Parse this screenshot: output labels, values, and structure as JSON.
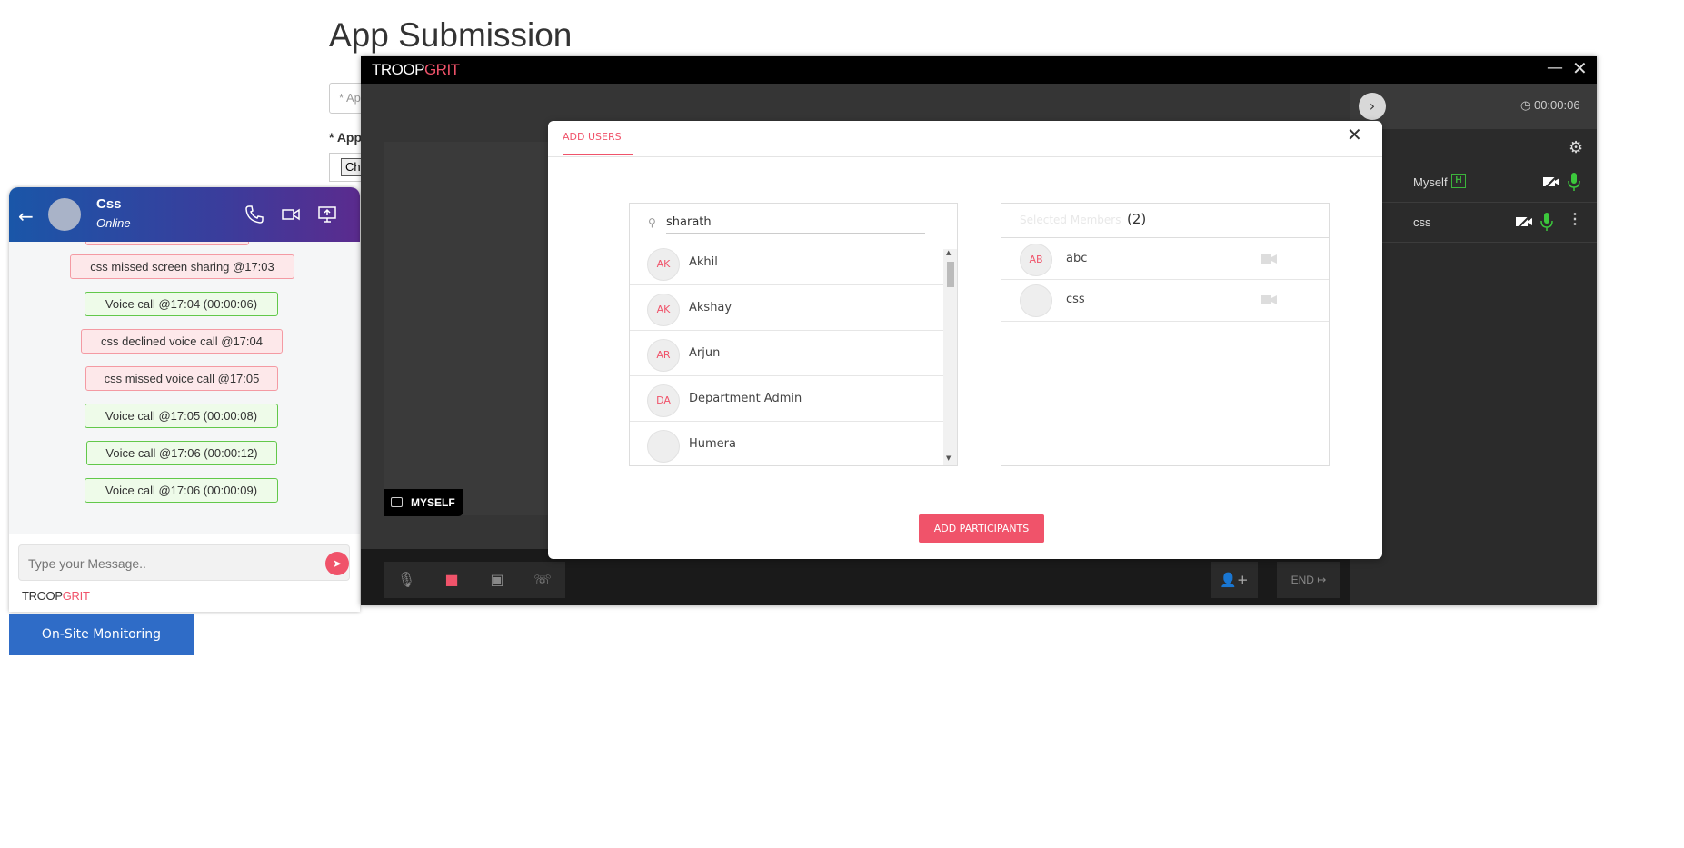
{
  "page": {
    "title": "App Submission",
    "input_placeholder": "* Ap",
    "label": "* App",
    "file_button": "Ch"
  },
  "chat": {
    "contact_name": "Css",
    "contact_status": "Online",
    "messages": [
      {
        "text": "css missed screen sharing @17:03",
        "type": "missed"
      },
      {
        "text": "Voice call @17:04 (00:00:06)",
        "type": "call"
      },
      {
        "text": "css declined voice call @17:04",
        "type": "missed"
      },
      {
        "text": "css missed voice call @17:05",
        "type": "missed"
      },
      {
        "text": "Voice call @17:05 (00:00:08)",
        "type": "call"
      },
      {
        "text": "Voice call @17:06 (00:00:12)",
        "type": "call"
      },
      {
        "text": "Voice call @17:06 (00:00:09)",
        "type": "call"
      }
    ],
    "input_placeholder": "Type your Message..",
    "brand_a": "TROOP",
    "brand_b": "GRIT"
  },
  "onsite_button": "On-Site Monitoring",
  "call": {
    "brand_a": "TROOP",
    "brand_b": "GRIT",
    "self_tag": "MYSELF",
    "timer": "00:00:06",
    "end_label": "END",
    "participants": [
      {
        "name": "Myself",
        "badge": "H"
      },
      {
        "name": "css"
      }
    ]
  },
  "modal": {
    "tab": "ADD USERS",
    "search_value": "sharath",
    "users": [
      {
        "initials": "AK",
        "name": "Akhil"
      },
      {
        "initials": "AK",
        "name": "Akshay"
      },
      {
        "initials": "AR",
        "name": "Arjun"
      },
      {
        "initials": "DA",
        "name": "Department Admin"
      },
      {
        "initials": "",
        "name": "Humera"
      }
    ],
    "selected_title": "Selected Members",
    "selected_count": "(2)",
    "selected": [
      {
        "initials": "AB",
        "name": "abc"
      },
      {
        "initials": "",
        "name": "css"
      }
    ],
    "add_button": "ADD PARTICIPANTS"
  },
  "colors": {
    "accent": "#f0536a",
    "onsite_blue": "#2f6cc7",
    "call_green": "#62c84a"
  }
}
